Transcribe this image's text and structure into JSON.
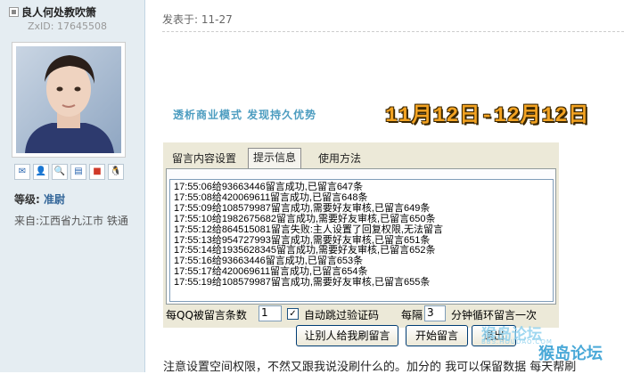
{
  "profile": {
    "username": "良人何处教吹箫",
    "zxid": "ZxID:  17645508",
    "level_label": "等级: ",
    "level_value": "准尉",
    "location": "来自:江西省九江市 铁通"
  },
  "post": {
    "time": "发表于: 11-27",
    "banner_slogan": "透析商业模式  发现持久优势",
    "banner_date": "11月12日-12月12日",
    "text": "注意设置空间权限，不然又跟我说没刷什么的。加分的  我可以保留数据  每天帮刷"
  },
  "tool": {
    "tabs": [
      {
        "label": "留言内容设置"
      },
      {
        "label": "提示信息"
      },
      {
        "label": "使用方法"
      }
    ],
    "log_lines": [
      "17:55:06给93663446留言成功,已留言647条",
      "17:55:08给420069611留言成功,已留言648条",
      "17:55:09给108579987留言成功,需要好友审核,已留言649条",
      "17:55:10给1982675682留言成功,需要好友审核,已留言650条",
      "17:55:12给864515081留言失败:主人设置了回复权限,无法留言",
      "17:55:13给954727993留言成功,需要好友审核,已留言651条",
      "17:55:14给1935628345留言成功,需要好友审核,已留言652条",
      "17:55:16给93663446留言成功,已留言653条",
      "17:55:17给420069611留言成功,已留言654条",
      "17:55:19给108579987留言成功,需要好友审核,已留言655条"
    ],
    "per_qq_label": "每QQ被留言条数",
    "per_qq_value": "1",
    "auto_captcha_label": "自动跳过验证码",
    "interval_label": "每隔",
    "interval_value": "3",
    "interval_unit": "分钟循环留言一次",
    "btn_let_others": "让别人给我刷留言",
    "btn_start": "开始留言",
    "btn_exit": "退出"
  },
  "watermarks": {
    "mark1": "猴岛论坛",
    "mark1_sub": "BBS.HOUDAO.COM",
    "mark2": "猴岛论坛"
  }
}
